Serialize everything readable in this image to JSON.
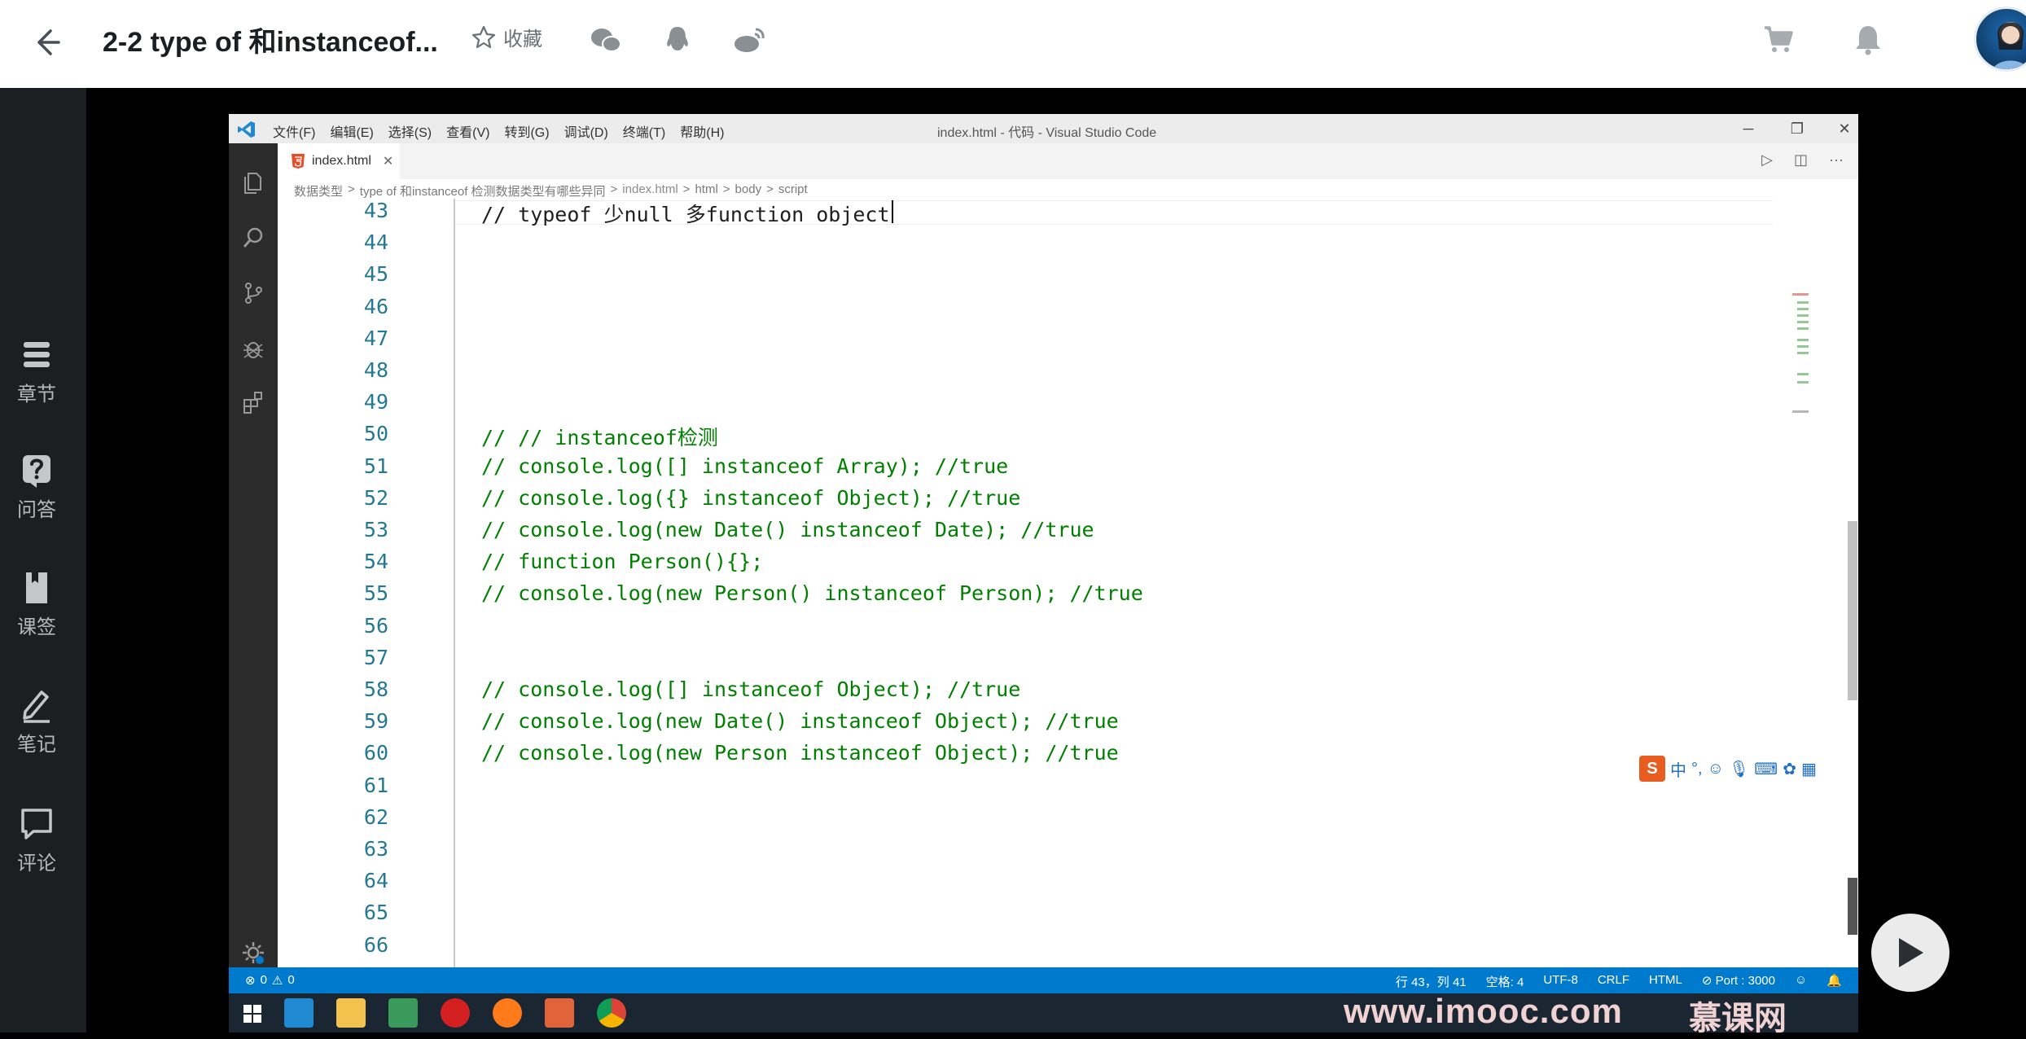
{
  "header": {
    "title": "2-2 type of 和instanceof...",
    "favorite_label": "收藏"
  },
  "sidebar": {
    "items": [
      {
        "label": "章节"
      },
      {
        "label": "问答"
      },
      {
        "label": "课签"
      },
      {
        "label": "笔记"
      },
      {
        "label": "评论"
      }
    ]
  },
  "vscode": {
    "menu": [
      "文件(F)",
      "编辑(E)",
      "选择(S)",
      "查看(V)",
      "转到(G)",
      "调试(D)",
      "终端(T)",
      "帮助(H)"
    ],
    "window_title": "index.html - 代码 - Visual Studio Code",
    "tab_label": "index.html",
    "breadcrumbs": [
      "数据类型",
      ">",
      "type of 和instanceof 检测数据类型有哪些异同",
      ">",
      "index.html",
      ">",
      "html",
      ">",
      "body",
      ">",
      "script"
    ],
    "lines": [
      {
        "n": "43",
        "code": "// typeof 少null 多function object"
      },
      {
        "n": "44",
        "code": ""
      },
      {
        "n": "45",
        "code": ""
      },
      {
        "n": "46",
        "code": ""
      },
      {
        "n": "47",
        "code": ""
      },
      {
        "n": "48",
        "code": ""
      },
      {
        "n": "49",
        "code": ""
      },
      {
        "n": "50",
        "code": "// // instanceof检测"
      },
      {
        "n": "51",
        "code": "// console.log([] instanceof Array); //true"
      },
      {
        "n": "52",
        "code": "// console.log({} instanceof Object); //true"
      },
      {
        "n": "53",
        "code": "// console.log(new Date() instanceof Date); //true"
      },
      {
        "n": "54",
        "code": "// function Person(){};"
      },
      {
        "n": "55",
        "code": "// console.log(new Person() instanceof Person); //true"
      },
      {
        "n": "56",
        "code": ""
      },
      {
        "n": "57",
        "code": ""
      },
      {
        "n": "58",
        "code": "// console.log([] instanceof Object); //true"
      },
      {
        "n": "59",
        "code": "// console.log(new Date() instanceof Object); //true"
      },
      {
        "n": "60",
        "code": "// console.log(new Person instanceof Object); //true"
      },
      {
        "n": "61",
        "code": ""
      },
      {
        "n": "62",
        "code": ""
      },
      {
        "n": "63",
        "code": ""
      },
      {
        "n": "64",
        "code": ""
      },
      {
        "n": "65",
        "code": ""
      },
      {
        "n": "66",
        "code": ""
      }
    ],
    "ime_label": "中",
    "status": {
      "errors": "0",
      "warnings": "0",
      "position": "行 43，列 41",
      "spaces": "空格: 4",
      "encoding": "UTF-8",
      "eol": "CRLF",
      "language": "HTML",
      "port": "Port : 3000"
    }
  },
  "watermark": "www.imooc.com",
  "watermark_cn": "慕课网",
  "colors": {
    "accent_status": "#007acc",
    "code_comment": "#008000",
    "line_number": "#237893"
  }
}
